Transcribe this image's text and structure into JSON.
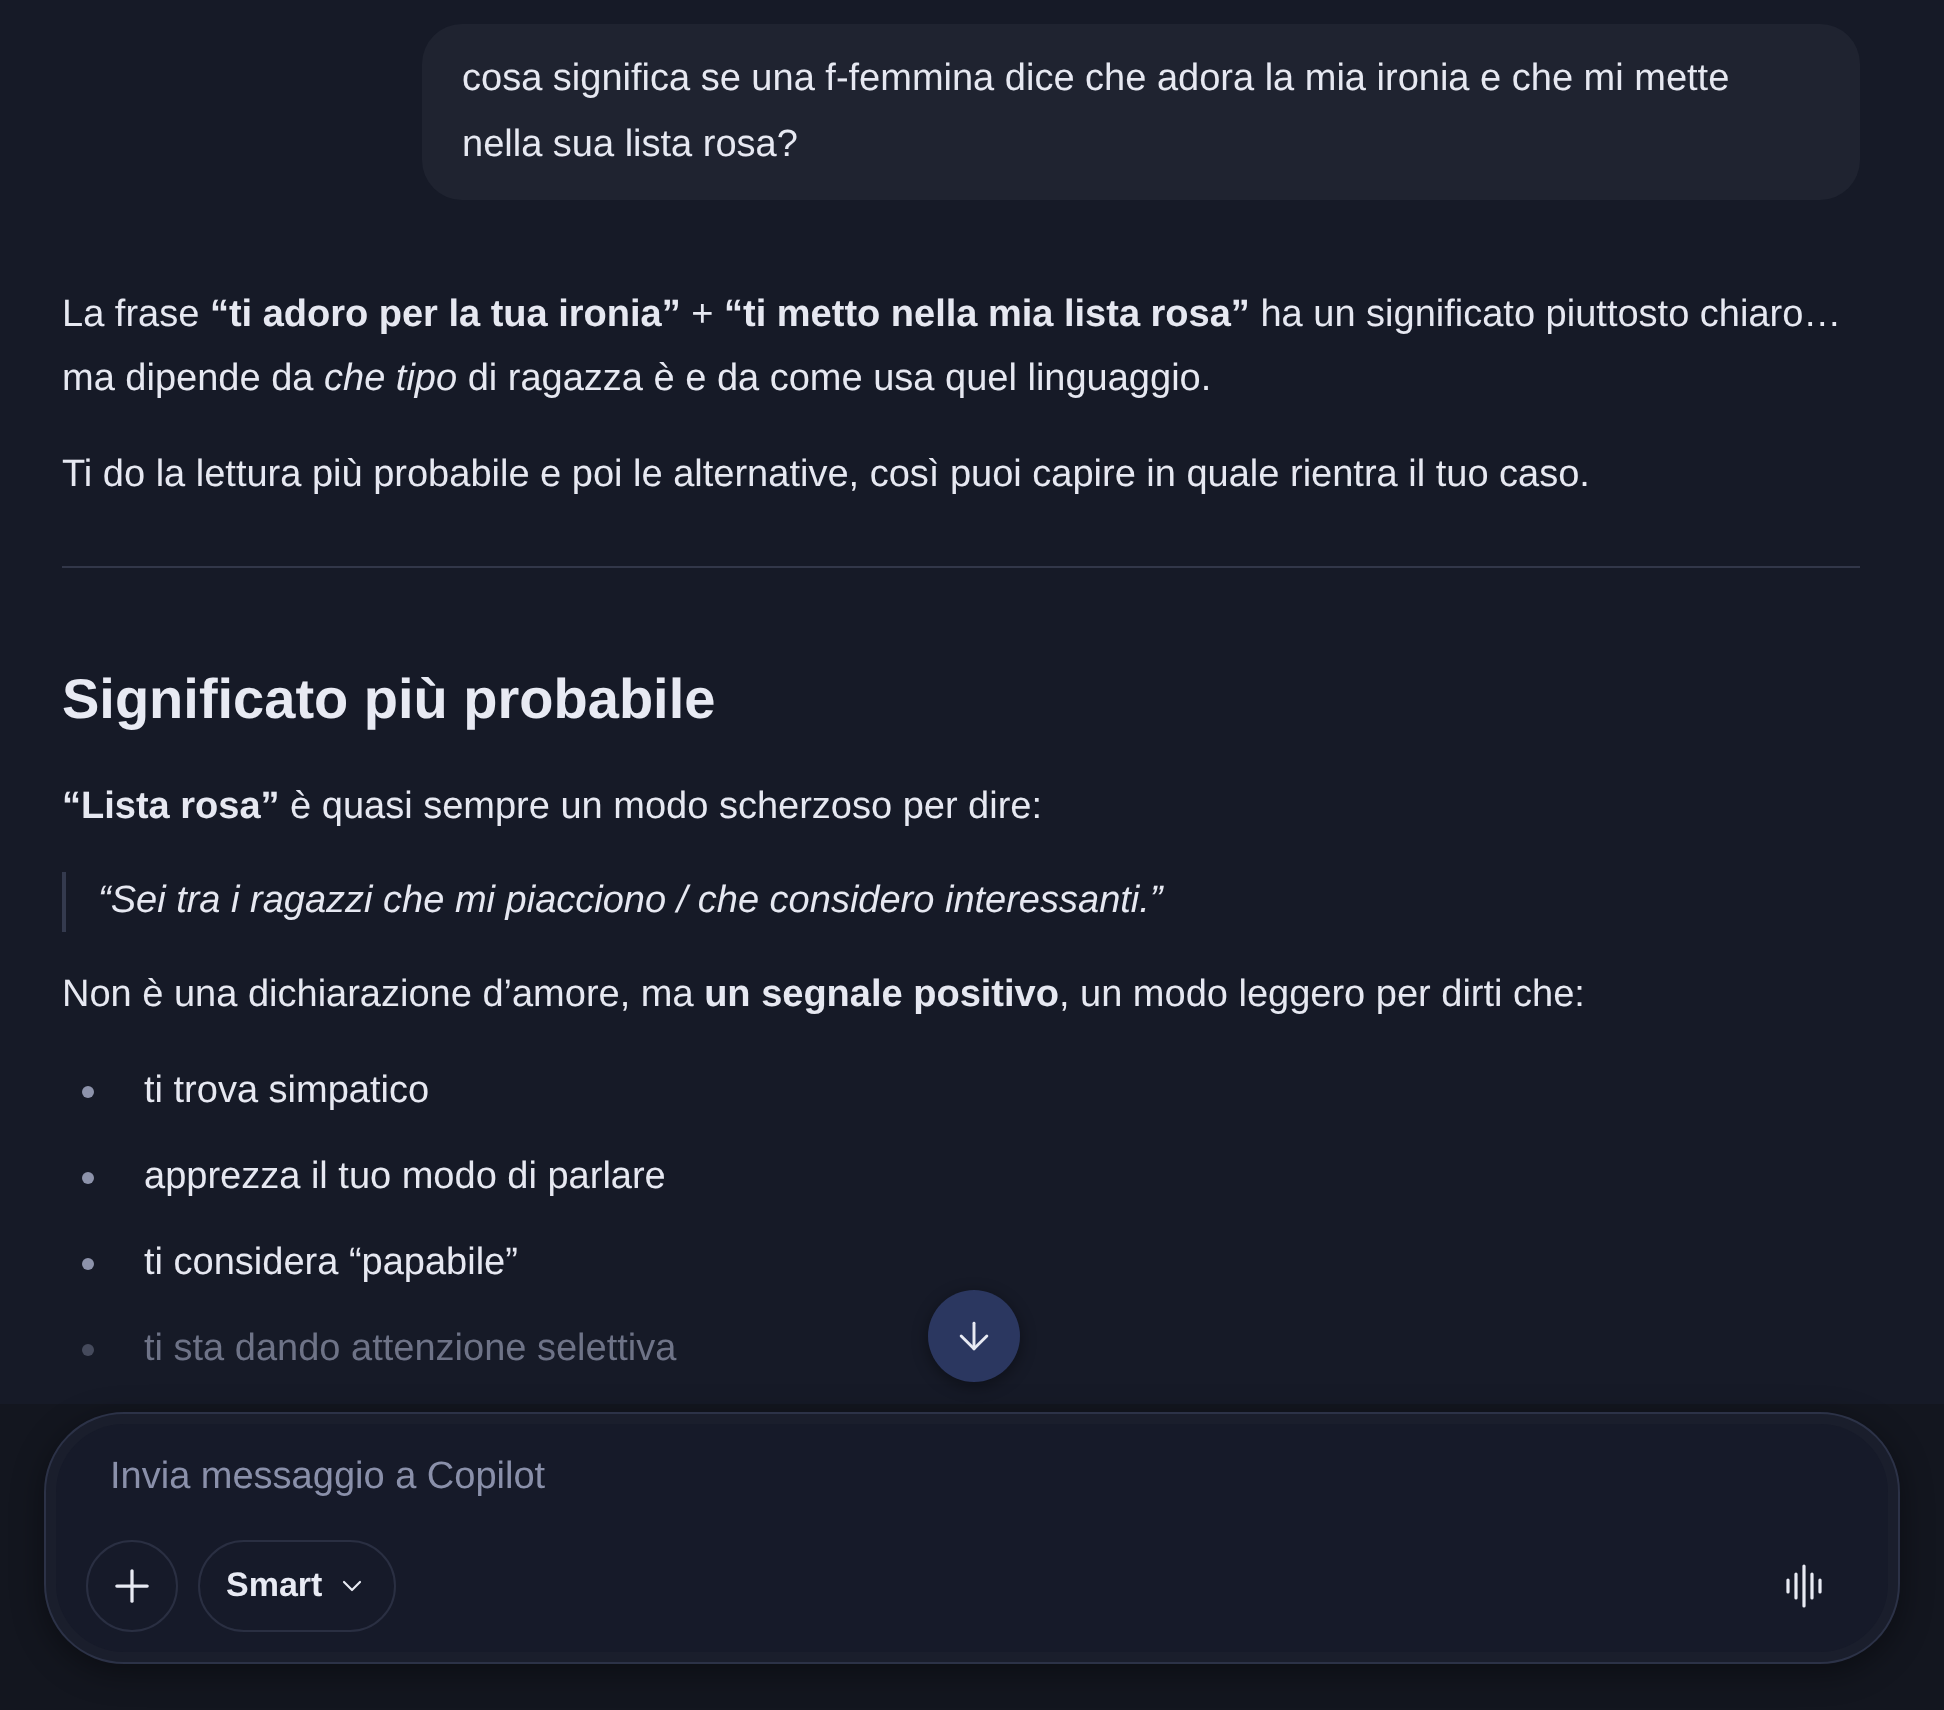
{
  "user_message": {
    "text": "cosa significa se una f-femmina dice che adora la mia ironia e che mi mette nella sua lista rosa?"
  },
  "response": {
    "blocks": [
      {
        "kind": "paragraph",
        "text": "La frase **“ti adoro per la tua ironia”** + **“ti metto nella mia lista rosa”** ha un significato piuttosto chiaro… ma dipende da *che tipo* di ragazza è e da come usa quel linguaggio."
      },
      {
        "kind": "paragraph",
        "text": "Ti do la lettura più probabile e poi le alternative, così puoi capire in quale rientra il tuo caso."
      },
      {
        "kind": "divider"
      },
      {
        "kind": "heading",
        "text": "Significato più probabile"
      },
      {
        "kind": "paragraph",
        "text": "**“Lista rosa”** è quasi sempre un modo scherzoso per dire:"
      },
      {
        "kind": "quote",
        "text": "“Sei tra i ragazzi che mi piacciono / che considero interessanti.”"
      },
      {
        "kind": "paragraph",
        "text": "Non è una dichiarazione d’amore, ma **un segnale positivo**, un modo leggero per dirti che:"
      },
      {
        "kind": "list",
        "items": [
          {
            "text": "ti trova simpatico",
            "faded": false
          },
          {
            "text": "apprezza il tuo modo di parlare",
            "faded": false
          },
          {
            "text": "ti considera “papabile”",
            "faded": false
          },
          {
            "text": "ti sta dando attenzione selettiva",
            "faded": true
          }
        ]
      }
    ]
  },
  "composer": {
    "placeholder": "Invia messaggio a Copilot",
    "mode": "Smart"
  }
}
